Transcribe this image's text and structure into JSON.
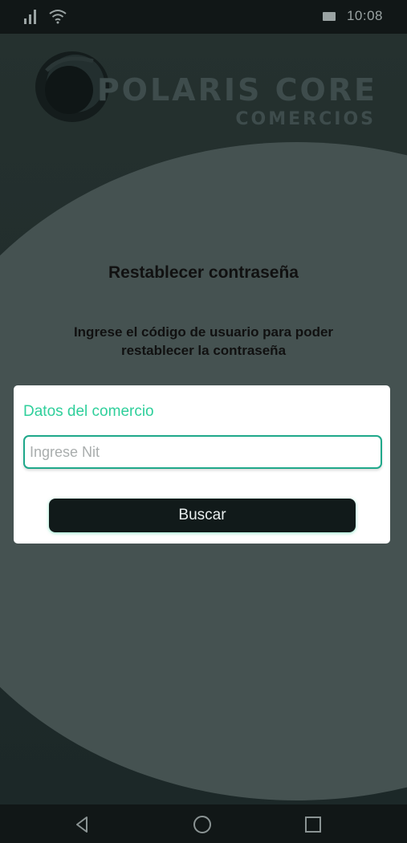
{
  "status_bar": {
    "time": "10:08",
    "icons": [
      "signal-icon",
      "wifi-icon",
      "battery-icon"
    ]
  },
  "brand": {
    "title": "POLARIS CORE",
    "subtitle": "COMERCIOS"
  },
  "page": {
    "title": "Restablecer contraseña",
    "instructions": "Ingrese el código de usuario para poder restablecer la contraseña"
  },
  "form": {
    "section_label": "Datos del comercio",
    "nit_placeholder": "Ingrese Nit",
    "nit_value": "",
    "search_label": "Buscar"
  },
  "nav_bar": {
    "icons": [
      "back-icon",
      "home-icon",
      "recents-icon"
    ]
  },
  "colors": {
    "accent": "#2fcf9b",
    "input_border": "#1fa88a",
    "background_dark": "#1a2525",
    "curve": "#455251",
    "button": "#111a1a"
  }
}
